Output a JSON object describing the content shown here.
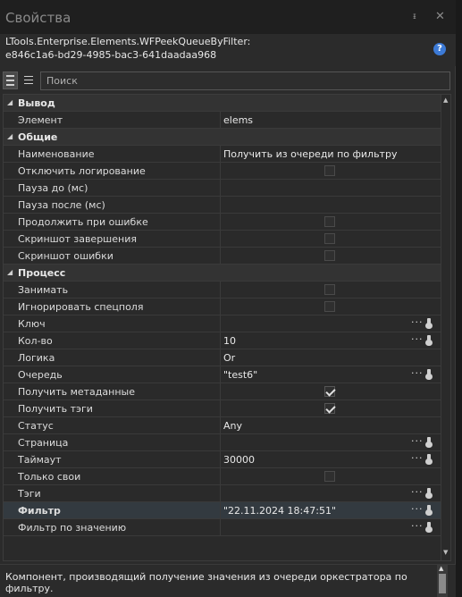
{
  "window": {
    "title": "Свойства",
    "pin_glyph": "ᵻ",
    "close_glyph": "✕"
  },
  "element_type": {
    "line1": "LTools.Enterprise.Elements.WFPeekQueueByFilter:",
    "line2": "e846c1a6-bd29-4985-bac3-641daadaa968",
    "help_glyph": "?"
  },
  "toolbar": {
    "search_placeholder": "Поиск"
  },
  "glyphs": {
    "expanded_arrow": "◢",
    "ellipsis": "···",
    "scroll_up": "▲",
    "scroll_down": "▼"
  },
  "grid": {
    "categories": [
      {
        "name": "Вывод",
        "rows": [
          {
            "name": "Элемент",
            "value": "elems"
          }
        ]
      },
      {
        "name": "Общие",
        "rows": [
          {
            "name": "Наименование",
            "value": "Получить из очереди по фильтру"
          },
          {
            "name": "Отключить логирование",
            "checkbox": false
          },
          {
            "name": "Пауза до (мс)",
            "value": ""
          },
          {
            "name": "Пауза после (мс)",
            "value": ""
          },
          {
            "name": "Продолжить при ошибке",
            "checkbox": false
          },
          {
            "name": "Скриншот завершения",
            "checkbox": false
          },
          {
            "name": "Скриншот ошибки",
            "checkbox": false
          }
        ]
      },
      {
        "name": "Процесс",
        "rows": [
          {
            "name": "Занимать",
            "checkbox": false
          },
          {
            "name": "Игнорировать спецполя",
            "checkbox": false
          },
          {
            "name": "Ключ",
            "value": "",
            "editor": true
          },
          {
            "name": "Кол-во",
            "value": "10",
            "editor": true
          },
          {
            "name": "Логика",
            "value": "Or"
          },
          {
            "name": "Очередь",
            "value": "\"test6\"",
            "editor": true
          },
          {
            "name": "Получить метаданные",
            "checkbox": true
          },
          {
            "name": "Получить тэги",
            "checkbox": true
          },
          {
            "name": "Статус",
            "value": "Any"
          },
          {
            "name": "Страница",
            "value": "",
            "editor": true
          },
          {
            "name": "Таймаут",
            "value": "30000",
            "editor": true
          },
          {
            "name": "Только свои",
            "checkbox": false
          },
          {
            "name": "Тэги",
            "value": "",
            "editor": true
          },
          {
            "name": "Фильтр",
            "value": "\"22.11.2024 18:47:51\"",
            "editor": true,
            "bold": true,
            "selected": true
          },
          {
            "name": "Фильтр по значению",
            "value": "",
            "editor": true
          }
        ]
      }
    ]
  },
  "description": "Компонент, производящий получение значения из очереди оркестратора по фильтру."
}
